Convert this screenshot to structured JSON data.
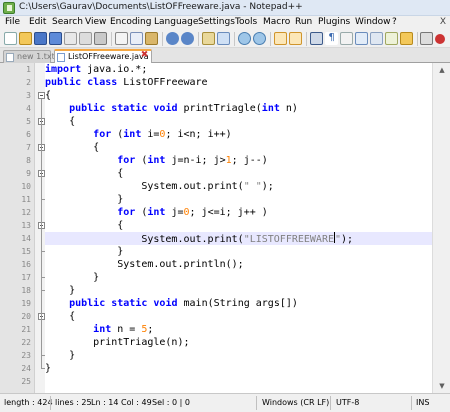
{
  "window": {
    "title": "C:\\Users\\Gaurav\\Documents\\ListOFFreeware.java - Notepad++"
  },
  "menu": {
    "items": [
      "File",
      "Edit",
      "Search",
      "View",
      "Encoding",
      "Language",
      "Settings",
      "Tools",
      "Macro",
      "Run",
      "Plugins",
      "Window",
      "?"
    ],
    "close": "X"
  },
  "toolbar": {
    "icons": [
      "new-file-icon",
      "open-file-icon",
      "save-icon",
      "save-all-icon",
      "close-icon",
      "close-all-icon",
      "print-icon",
      "cut-icon",
      "copy-icon",
      "paste-icon",
      "undo-icon",
      "redo-icon",
      "find-icon",
      "replace-icon",
      "zoom-in-icon",
      "zoom-out-icon",
      "sync-v-icon",
      "sync-h-icon",
      "wrap-icon",
      "all-chars-icon",
      "indent-guide-icon",
      "lang-icon",
      "doc-map-icon",
      "function-list-icon",
      "folder-icon",
      "monitor-icon",
      "record-macro-icon",
      "stop-macro-icon",
      "play-macro-icon",
      "run-macro-icon",
      "save-macro-icon"
    ]
  },
  "tabs": [
    {
      "label": "new 1.txt",
      "active": false
    },
    {
      "label": "ListOFFreeware.java",
      "active": true,
      "close": "✖"
    }
  ],
  "editor": {
    "line_numbers": [
      "1",
      "2",
      "3",
      "4",
      "5",
      "6",
      "7",
      "8",
      "9",
      "10",
      "11",
      "12",
      "13",
      "14",
      "15",
      "16",
      "17",
      "18",
      "19",
      "20",
      "21",
      "22",
      "23",
      "24",
      "25"
    ],
    "current_line": 14,
    "code": {
      "l1": [
        "import",
        " java.io.*;"
      ],
      "l2": [
        "public",
        " ",
        "class",
        " ListOFFreeware"
      ],
      "l3": [
        "{"
      ],
      "l4": [
        "    ",
        "public",
        " ",
        "static",
        " ",
        "void",
        " printTriagle(",
        "int",
        " n)"
      ],
      "l5": [
        "    {"
      ],
      "l6": [
        "        ",
        "for",
        " (",
        "int",
        " i=",
        "0",
        "; i<n; i++)"
      ],
      "l7": [
        "        {"
      ],
      "l8": [
        "            ",
        "for",
        " (",
        "int",
        " j=n-i; j>",
        "1",
        "; j--)"
      ],
      "l9": [
        "            {"
      ],
      "l10": [
        "                System.out.print(",
        "\" \"",
        ");"
      ],
      "l11": [
        "            }"
      ],
      "l12": [
        "            ",
        "for",
        " (",
        "int",
        " j=",
        "0",
        "; j<=i; j++ )"
      ],
      "l13": [
        "            {"
      ],
      "l14": [
        "                System.out.print(",
        "\"LISTOFFREEWARE",
        "\"",
        ");"
      ],
      "l15": [
        "            }"
      ],
      "l16": [
        "            System.out.println();"
      ],
      "l17": [
        "        }"
      ],
      "l18": [
        "    }"
      ],
      "l19": [
        "    ",
        "public",
        " ",
        "static",
        " ",
        "void",
        " main(String args[])"
      ],
      "l20": [
        "    {"
      ],
      "l21": [
        "        ",
        "int",
        " n = ",
        "5",
        ";"
      ],
      "l22": [
        "        printTriagle(n);"
      ],
      "l23": [
        "    }"
      ],
      "l24": [
        "}"
      ],
      "l25": [
        ""
      ]
    }
  },
  "status": {
    "length": "length : 424",
    "lines": "lines : 25",
    "ln": "Ln : 14",
    "col": "Col : 49",
    "sel": "Sel : 0 | 0",
    "eol": "Windows (CR LF)",
    "encoding": "UTF-8",
    "mode": "INS"
  },
  "colors": {
    "keyword": "#0000ff",
    "number": "#ff8000",
    "string": "#808080",
    "current_line": "#e8e8ff",
    "tab_accent": "#f4a742"
  }
}
